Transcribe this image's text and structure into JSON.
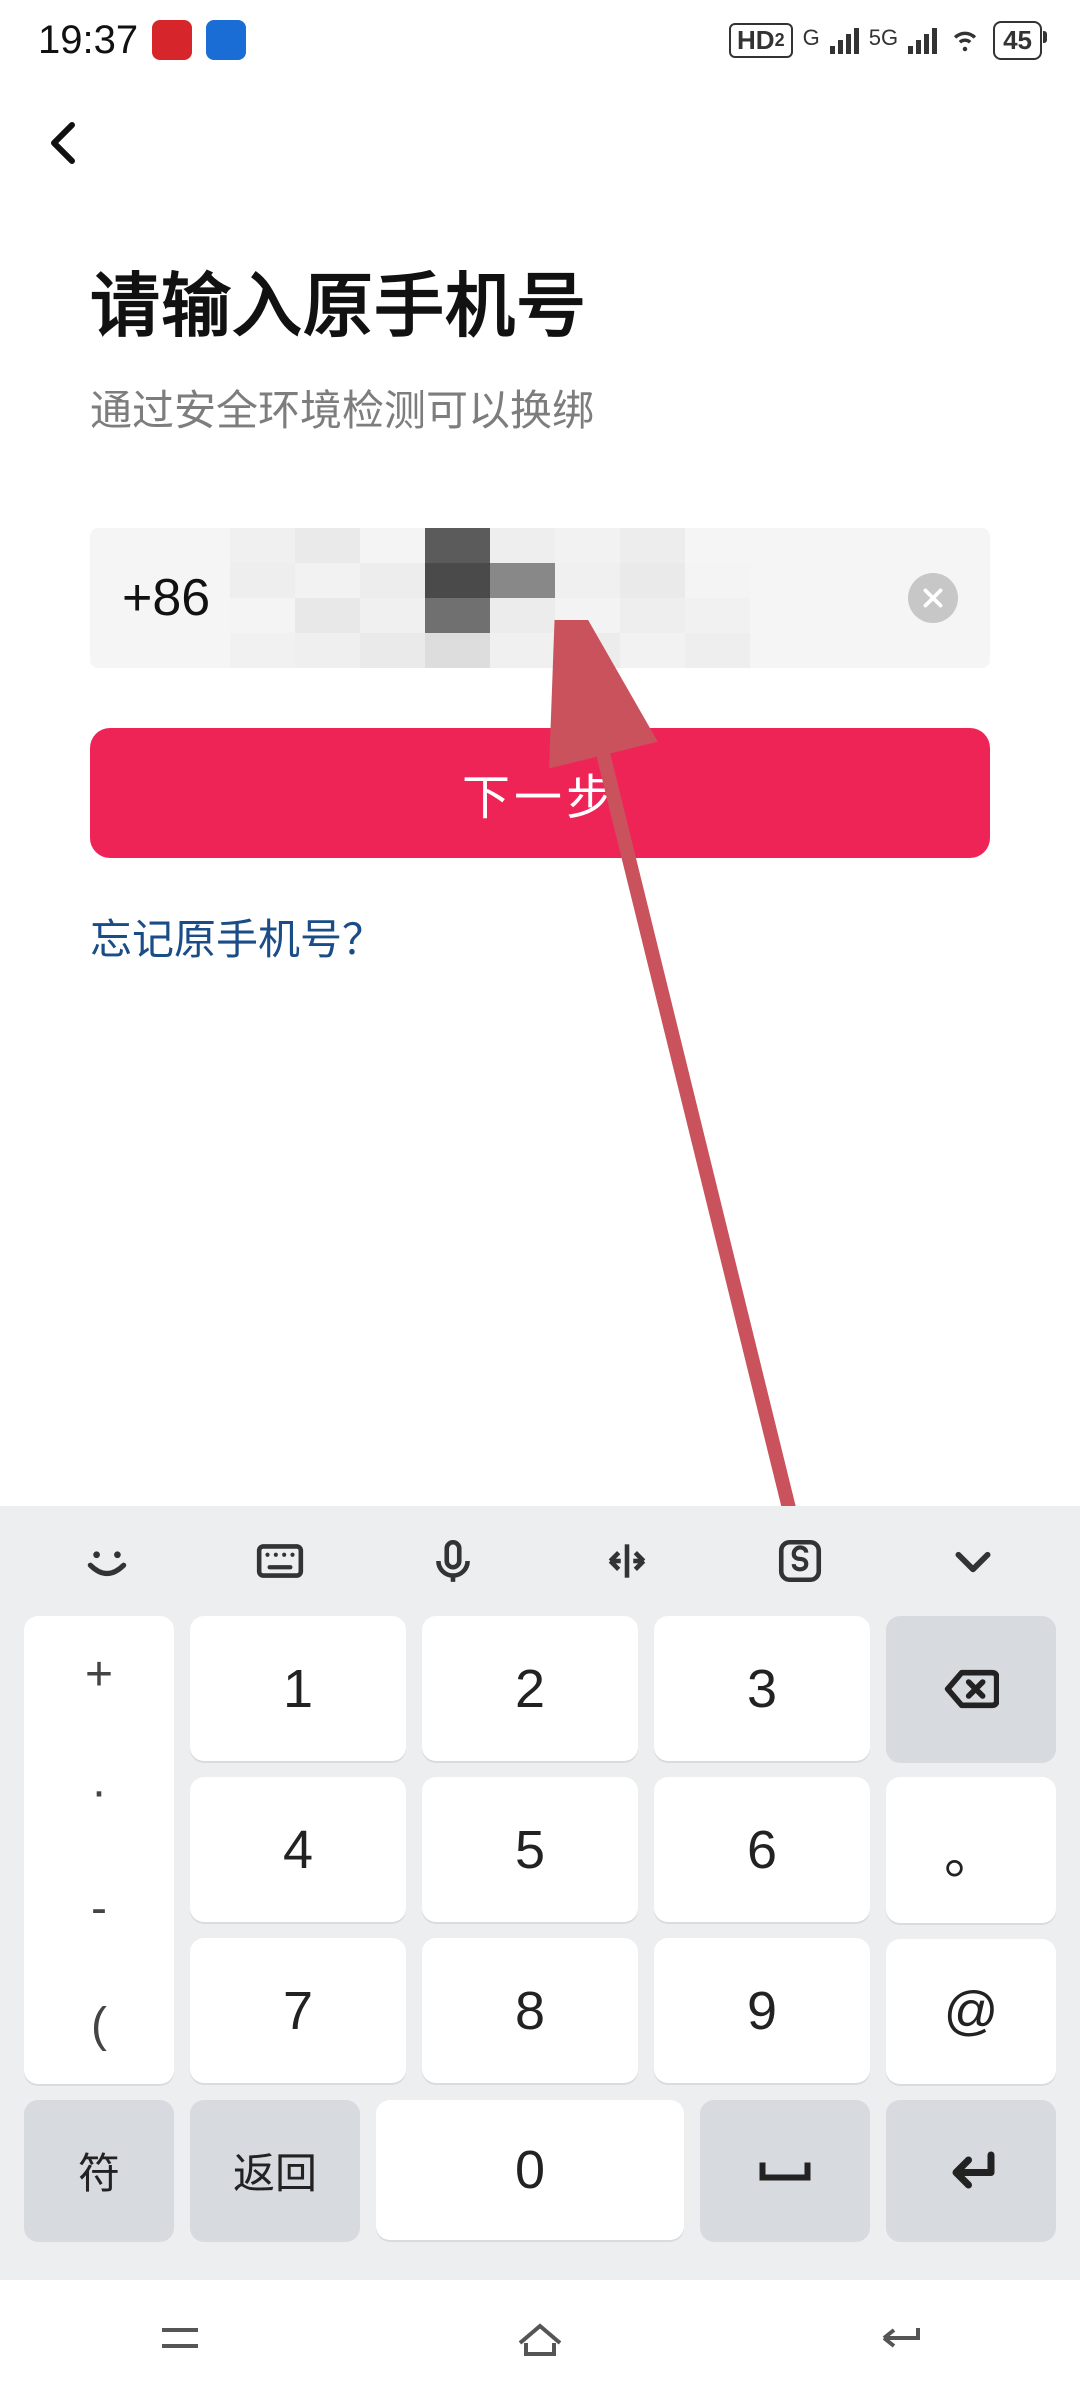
{
  "statusbar": {
    "time": "19:37",
    "hd_label": "HD",
    "hd_sub": "2",
    "net1_label": "G",
    "net2_label": "5G",
    "battery": "45"
  },
  "page": {
    "title": "请输入原手机号",
    "subtitle": "通过安全环境检测可以换绑",
    "country_code": "+86",
    "next_button": "下一步",
    "forgot_link": "忘记原手机号？"
  },
  "keyboard": {
    "side": {
      "plus": "+",
      "dot": "·",
      "minus": "-",
      "lparen": "("
    },
    "nums": {
      "1": "1",
      "2": "2",
      "3": "3",
      "4": "4",
      "5": "5",
      "6": "6",
      "7": "7",
      "8": "8",
      "9": "9",
      "0": "0"
    },
    "right": {
      "period": "。",
      "at": "@"
    },
    "bottom": {
      "sym": "符",
      "return": "返回"
    }
  }
}
